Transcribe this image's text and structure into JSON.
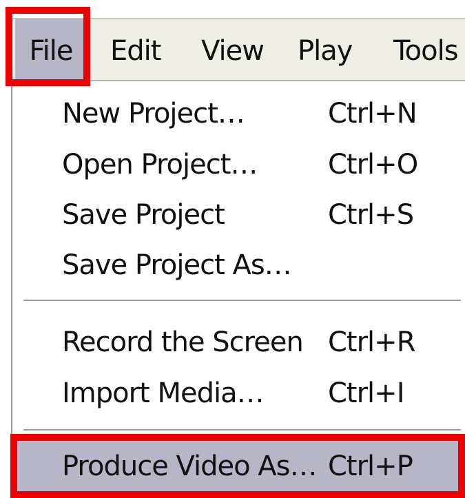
{
  "menubar": {
    "items": [
      {
        "label": "File"
      },
      {
        "label": "Edit"
      },
      {
        "label": "View"
      },
      {
        "label": "Play"
      },
      {
        "label": "Tools"
      }
    ],
    "active_item": "File"
  },
  "file_menu": {
    "items": [
      {
        "label": "New Project…",
        "shortcut": "Ctrl+N"
      },
      {
        "label": "Open Project…",
        "shortcut": "Ctrl+O"
      },
      {
        "label": "Save Project",
        "shortcut": "Ctrl+S"
      },
      {
        "label": "Save Project As…",
        "shortcut": ""
      },
      {
        "label": "Record the Screen",
        "shortcut": "Ctrl+R"
      },
      {
        "label": "Import Media…",
        "shortcut": "Ctrl+I"
      },
      {
        "label": "Produce Video As…",
        "shortcut": "Ctrl+P"
      }
    ],
    "highlighted_item": "Produce Video As…"
  },
  "colors": {
    "menubar_bg": "#eeeee6",
    "selected_bg": "#b6b6c8",
    "annotation_red": "#ee0000",
    "text": "#111111"
  }
}
